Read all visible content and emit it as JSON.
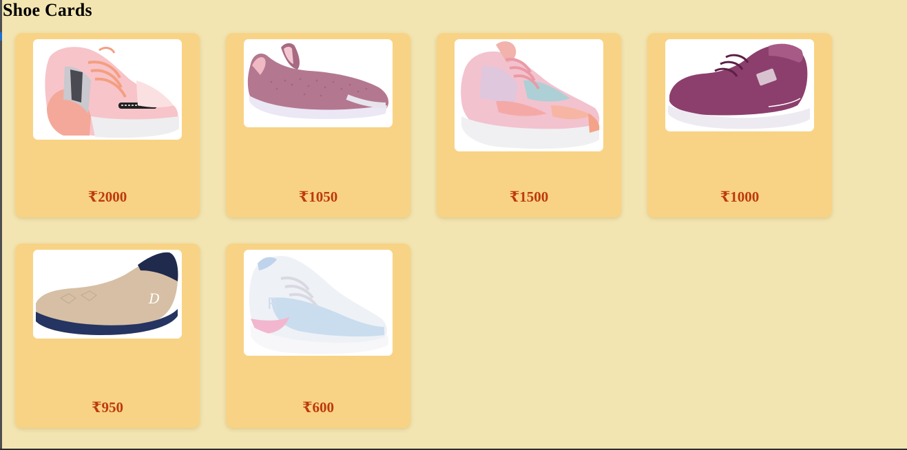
{
  "page": {
    "title": "Shoe Cards"
  },
  "cards": [
    {
      "image": "pink-chunky-sneaker",
      "price": "₹2000"
    },
    {
      "image": "mauve-slip-on-shoe",
      "price": "₹1050"
    },
    {
      "image": "tie-dye-pink-sneaker",
      "price": "₹1500"
    },
    {
      "image": "plum-lace-up-sneaker",
      "price": "₹1000"
    },
    {
      "image": "beige-knit-loafer",
      "price": "₹950"
    },
    {
      "image": "pastel-white-runner",
      "price": "₹600"
    }
  ],
  "colors": {
    "page_background": "#f3e5b1",
    "card_background": "#f8d385",
    "price_text": "#bd3a0e"
  }
}
